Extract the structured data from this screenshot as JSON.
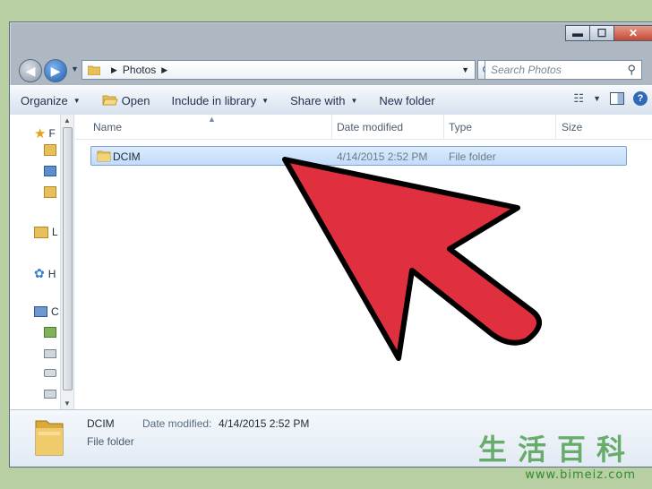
{
  "window": {
    "caption": {
      "minimize": "▬",
      "maximize": "☐",
      "close": "✕"
    }
  },
  "address": {
    "path": [
      "Photos"
    ],
    "search_placeholder": "Search Photos"
  },
  "toolbar": {
    "organize": "Organize",
    "open": "Open",
    "include_in_library": "Include in library",
    "share_with": "Share with",
    "new_folder": "New folder"
  },
  "columns": {
    "name": "Name",
    "date_modified": "Date modified",
    "type": "Type",
    "size": "Size"
  },
  "nav_pane": [
    {
      "label": "F",
      "icon": "favorites-star-icon"
    },
    {
      "label": "",
      "icon": "downloads-folder-icon"
    },
    {
      "label": "",
      "icon": "desktop-icon"
    },
    {
      "label": "",
      "icon": "recent-places-icon"
    },
    {
      "label": "L",
      "icon": "libraries-icon"
    },
    {
      "label": "H",
      "icon": "homegroup-icon"
    },
    {
      "label": "C",
      "icon": "computer-icon"
    },
    {
      "label": "",
      "icon": "drive-icon"
    },
    {
      "label": "",
      "icon": "network-drive-icon"
    },
    {
      "label": "",
      "icon": "removable-drive-icon"
    },
    {
      "label": "",
      "icon": "network-drive-icon"
    }
  ],
  "files": [
    {
      "name": "DCIM",
      "date_modified": "4/14/2015 2:52 PM",
      "type": "File folder",
      "size": ""
    }
  ],
  "details": {
    "name": "DCIM",
    "date_label": "Date modified:",
    "date_value": "4/14/2015 2:52 PM",
    "type": "File folder"
  },
  "overlay": {
    "arrow_color": "#e0303f"
  },
  "watermark": {
    "chars": "生活百科",
    "url": "www.bimeiz.com"
  }
}
